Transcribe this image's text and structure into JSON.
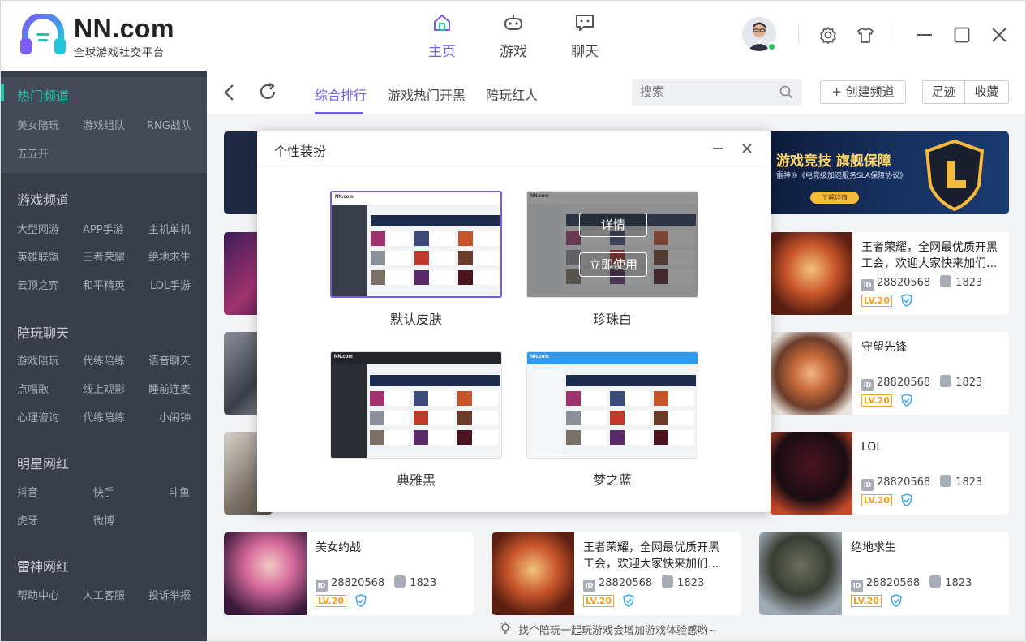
{
  "app": {
    "brand": "NN.com",
    "slogan": "全球游戏社交平台",
    "accent": "#6f5cf0",
    "teal": "#22c5a8"
  },
  "topnav": [
    {
      "label": "主页",
      "icon": "home-icon",
      "active": true
    },
    {
      "label": "游戏",
      "icon": "gamepad-icon",
      "active": false
    },
    {
      "label": "聊天",
      "icon": "chat-icon",
      "active": false
    }
  ],
  "window_controls": [
    "settings-icon",
    "skin-shirt-icon",
    "minimize-icon",
    "maximize-icon",
    "close-icon"
  ],
  "sidebar": {
    "hot": {
      "title": "热门频道",
      "items": [
        "美女陪玩",
        "游戏组队",
        "RNG战队",
        "五五开"
      ]
    },
    "game": {
      "title": "游戏频道",
      "items": [
        "大型网游",
        "APP手游",
        "主机单机",
        "英雄联盟",
        "王者荣耀",
        "绝地求生",
        "云顶之弈",
        "和平精英",
        "LOL手游"
      ]
    },
    "chat": {
      "title": "陪玩聊天",
      "items": [
        "游戏陪玩",
        "代练陪练",
        "语音聊天",
        "点唱歌",
        "线上观影",
        "睡前连麦",
        "心理咨询",
        "代练陪练",
        "小闹钟"
      ]
    },
    "star": {
      "title": "明星网红",
      "items": [
        "抖音",
        "快手",
        "斗鱼",
        "虎牙",
        "微博"
      ]
    },
    "leishen": {
      "title": "雷神网红",
      "items": [
        "帮助中心",
        "人工客服",
        "投诉举报"
      ]
    }
  },
  "tabs": [
    "综合排行",
    "游戏热门开黑",
    "陪玩红人"
  ],
  "search": {
    "placeholder": "搜索"
  },
  "buttons": {
    "create": "+ 创建频道",
    "footprint": "足迹",
    "favorite": "收藏"
  },
  "banner": {
    "title": "游戏竞技 旗舰保障",
    "subtitle": "雷神®《电竞级加速服务SLA保障协议》",
    "button": "了解详情"
  },
  "cards": [
    {
      "title": "王者荣耀，全网最优质开黑工会，欢迎大家快来加们...",
      "id": "28820568",
      "fans": "1823",
      "level": "LV.20"
    },
    {
      "title": "守望先锋",
      "id": "28820568",
      "fans": "1823",
      "level": "LV.20"
    },
    {
      "title": "LOL",
      "id": "28820568",
      "fans": "1823",
      "level": "LV.20"
    },
    {
      "title": "美女约战",
      "id": "28820568",
      "fans": "1823",
      "level": "LV.20"
    },
    {
      "title": "王者荣耀，全网最优质开黑工会，欢迎大家快来加们...",
      "id": "28820568",
      "fans": "1823",
      "level": "LV.20"
    },
    {
      "title": "绝地求生",
      "id": "28820568",
      "fans": "1823",
      "level": "LV.20"
    }
  ],
  "id_badge": "ID",
  "modal": {
    "title": "个性装扮",
    "skins": [
      {
        "name": "默认皮肤",
        "selected": true
      },
      {
        "name": "珍珠白",
        "hover_buttons": [
          "详情",
          "立即使用"
        ]
      },
      {
        "name": "典雅黑"
      },
      {
        "name": "梦之蓝"
      }
    ]
  },
  "tip": "找个陪玩一起玩游戏会增加游戏体验感哟~"
}
